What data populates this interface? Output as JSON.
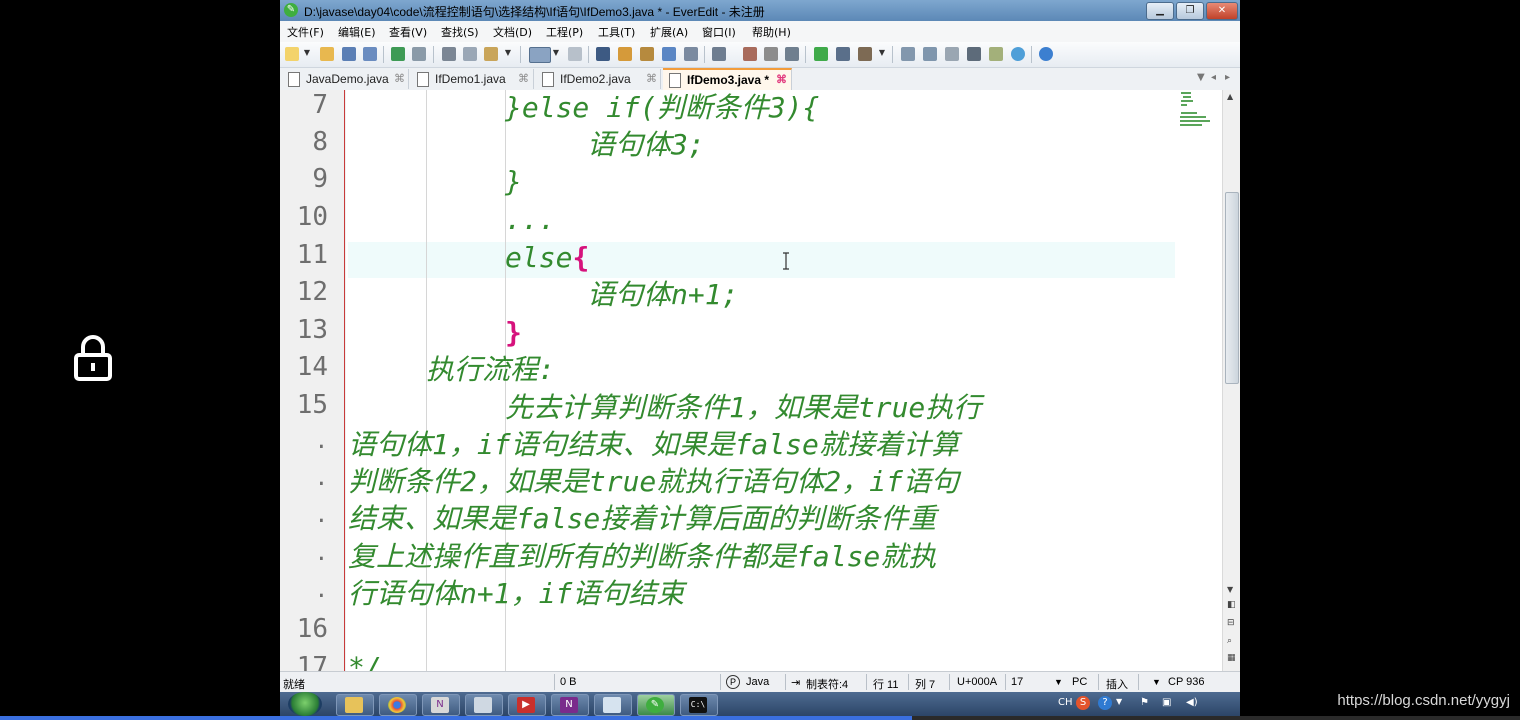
{
  "window": {
    "title": "D:\\javase\\day04\\code\\流程控制语句\\选择结构\\If语句\\IfDemo3.java * - EverEdit - 未注册",
    "min_label": "▁",
    "max_label": "❐",
    "close_label": "✕"
  },
  "menu": [
    "文件(F)",
    "编辑(E)",
    "查看(V)",
    "查找(S)",
    "文档(D)",
    "工程(P)",
    "工具(T)",
    "扩展(A)",
    "窗口(I)",
    "帮助(H)"
  ],
  "tabs": [
    {
      "label": "JavaDemo.java",
      "close": "⌘",
      "active": false
    },
    {
      "label": "IfDemo1.java",
      "close": "⌘",
      "active": false
    },
    {
      "label": "IfDemo2.java",
      "close": "⌘",
      "active": false
    },
    {
      "label": "IfDemo3.java *",
      "close": "⌘",
      "active": true
    }
  ],
  "code_lines": [
    {
      "num": "7",
      "text": "}else if(判断条件3){"
    },
    {
      "num": "8",
      "text": "语句体3;"
    },
    {
      "num": "9",
      "text": "}"
    },
    {
      "num": "10",
      "text": "..."
    },
    {
      "num": "11",
      "text": "else",
      "brace": "{"
    },
    {
      "num": "12",
      "text": "语句体n+1;"
    },
    {
      "num": "13",
      "brace": "}"
    },
    {
      "num": "14",
      "text": "执行流程:"
    },
    {
      "num": "15",
      "text": "先去计算判断条件1，如果是true执行"
    },
    {
      "num": ".",
      "text": "语句体1，if语句结束、如果是false就接着计算"
    },
    {
      "num": ".",
      "text": "判断条件2，如果是true就执行语句体2，if语句"
    },
    {
      "num": ".",
      "text": "结束、如果是false接着计算后面的判断条件重"
    },
    {
      "num": ".",
      "text": "复上述操作直到所有的判断条件都是false就执"
    },
    {
      "num": ".",
      "text": "行语句体n+1，if语句结束"
    },
    {
      "num": "16",
      "text": ""
    },
    {
      "num": "17",
      "text": "*/"
    }
  ],
  "status": {
    "ready": "就绪",
    "size": "0 B",
    "lang": "Java",
    "tab": "制表符:4",
    "line": "行 11",
    "col": "列 7",
    "char": "U+000A",
    "num": "17",
    "eol": "PC",
    "mode": "插入",
    "encoding": "CP 936"
  },
  "tray": {
    "ime": "CH"
  },
  "watermark": "https://blog.csdn.net/yygyj",
  "colors": {
    "code": "#338a2f",
    "brace": "#d6127c",
    "gutter_line": "#c83a3a",
    "highlight": "#effbfb"
  },
  "icons": [
    "lock-icon",
    "app-icon",
    "new-file-icon",
    "open-icon",
    "save-icon",
    "save-all-icon",
    "undo-icon",
    "redo-icon",
    "cut-icon",
    "copy-icon",
    "paste-icon",
    "find-icon",
    "replace-icon",
    "run-icon",
    "help-icon",
    "text-cursor-icon"
  ]
}
